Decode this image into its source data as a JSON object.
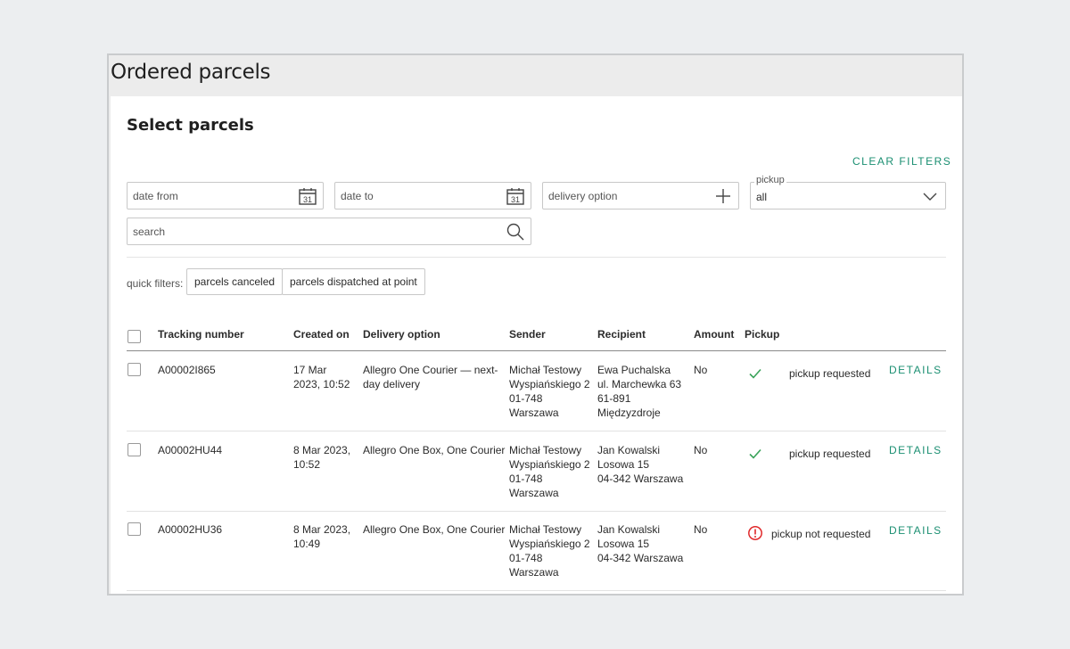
{
  "window": {
    "title": "Ordered parcels"
  },
  "section_title": "Select parcels",
  "clear_filters": "CLEAR FILTERS",
  "filters": {
    "date_from": {
      "placeholder": "date from",
      "icon": "calendar-icon",
      "icon_text": "31"
    },
    "date_to": {
      "placeholder": "date to",
      "icon": "calendar-icon",
      "icon_text": "31"
    },
    "delivery_option": {
      "placeholder": "delivery option",
      "icon": "plus-icon"
    },
    "pickup": {
      "legend": "pickup",
      "value": "all",
      "icon": "chevron-down-icon"
    },
    "search": {
      "placeholder": "search",
      "icon": "search-icon"
    }
  },
  "quick_filters": {
    "label": "quick filters:",
    "chips": [
      "parcels canceled",
      "parcels dispatched at point"
    ]
  },
  "table": {
    "headers": [
      "Tracking number",
      "Created on",
      "Delivery option",
      "Sender",
      "Recipient",
      "Amount",
      "Pickup"
    ],
    "rows": [
      {
        "tracking": "A00002I865",
        "created": [
          "17 Mar",
          "2023, 10:52"
        ],
        "delivery": [
          "Allegro One Courier — next-",
          "day delivery"
        ],
        "sender": [
          "Michał Testowy",
          "Wyspiańskiego 2",
          "01-748",
          "Warszawa"
        ],
        "recipient": [
          "Ewa Puchalska",
          "ul. Marchewka 63",
          "61-891",
          "Międzyzdroje"
        ],
        "amount": "No",
        "pickup_status": "pickup requested",
        "pickup_icon": "check-icon",
        "action": "DETAILS"
      },
      {
        "tracking": "A00002HU44",
        "created": [
          "8 Mar 2023,",
          "10:52"
        ],
        "delivery": [
          "Allegro One Box, One Courier"
        ],
        "sender": [
          "Michał Testowy",
          "Wyspiańskiego 2",
          "01-748",
          "Warszawa"
        ],
        "recipient": [
          "Jan Kowalski",
          "Losowa 15",
          "04-342 Warszawa"
        ],
        "amount": "No",
        "pickup_status": "pickup requested",
        "pickup_icon": "check-icon",
        "action": "DETAILS"
      },
      {
        "tracking": "A00002HU36",
        "created": [
          "8 Mar 2023,",
          "10:49"
        ],
        "delivery": [
          "Allegro One Box, One Courier"
        ],
        "sender": [
          "Michał Testowy",
          "Wyspiańskiego 2",
          "01-748",
          "Warszawa"
        ],
        "recipient": [
          "Jan Kowalski",
          "Losowa 15",
          "04-342 Warszawa"
        ],
        "amount": "No",
        "pickup_status": "pickup not requested",
        "pickup_icon": "warning-circle-icon",
        "action": "DETAILS"
      }
    ]
  },
  "colors": {
    "accent": "#1b8f72",
    "check": "#3aa35a",
    "warning": "#e0282a"
  }
}
